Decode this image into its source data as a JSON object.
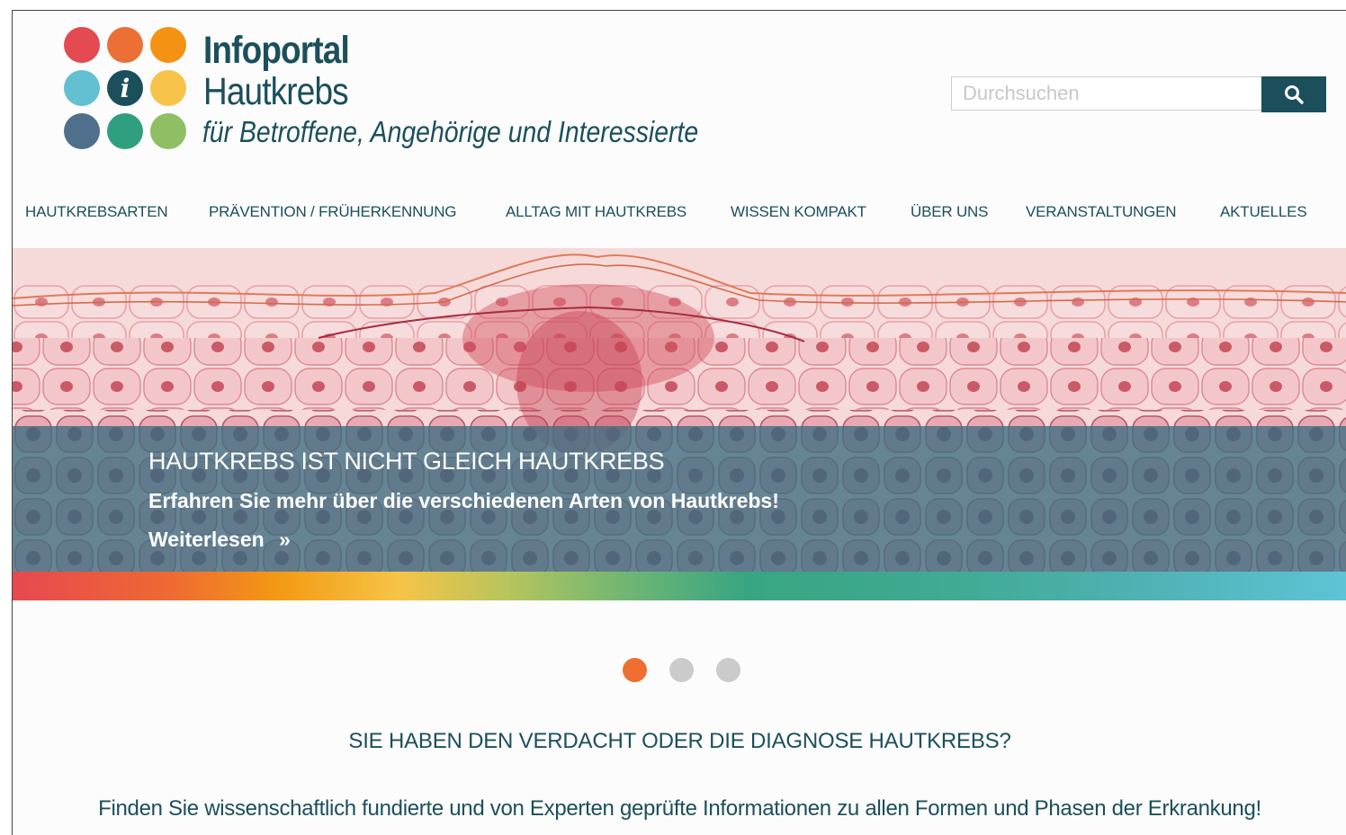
{
  "logo": {
    "line1": "Infoportal",
    "line2": "Hautkrebs",
    "tagline": "für Betroffene, Angehörige und Interessierte",
    "info_glyph": "i",
    "dot_colors": [
      "#e44a52",
      "#ec7035",
      "#f39213",
      "#63c0d2",
      "#1b4f5c",
      "#f7c34a",
      "#4f6f8d",
      "#2f9f7f",
      "#8fbf64"
    ]
  },
  "search": {
    "placeholder": "Durchsuchen",
    "value": "",
    "button_icon": "search-icon"
  },
  "nav": {
    "items": [
      {
        "label": "HAUTKREBSARTEN"
      },
      {
        "label": "PRÄVENTION / FRÜHERKENNUNG"
      },
      {
        "label": "ALLTAG MIT HAUTKREBS"
      },
      {
        "label": "WISSEN KOMPAKT"
      },
      {
        "label": "ÜBER UNS"
      },
      {
        "label": "VERANSTALTUNGEN"
      },
      {
        "label": "AKTUELLES"
      }
    ]
  },
  "hero": {
    "title": "HAUTKREBS IST NICHT GLEICH HAUTKREBS",
    "subtitle": "Erfahren Sie mehr über die verschiedenen Arten von Hautkrebs!",
    "link_label": "Weiterlesen",
    "link_icon": "»"
  },
  "carousel": {
    "slides": 3,
    "active_index": 0
  },
  "section": {
    "title": "SIE HABEN DEN VERDACHT ODER DIE DIAGNOSE HAUTKREBS?",
    "text": "Finden Sie wissenschaftlich fundierte und von Experten geprüfte Informationen zu allen Formen und Phasen der Erkrankung!"
  },
  "colors": {
    "brand": "#1b4f5c",
    "accent": "#ee6f30",
    "inactive_dot": "#cbcbcb"
  }
}
